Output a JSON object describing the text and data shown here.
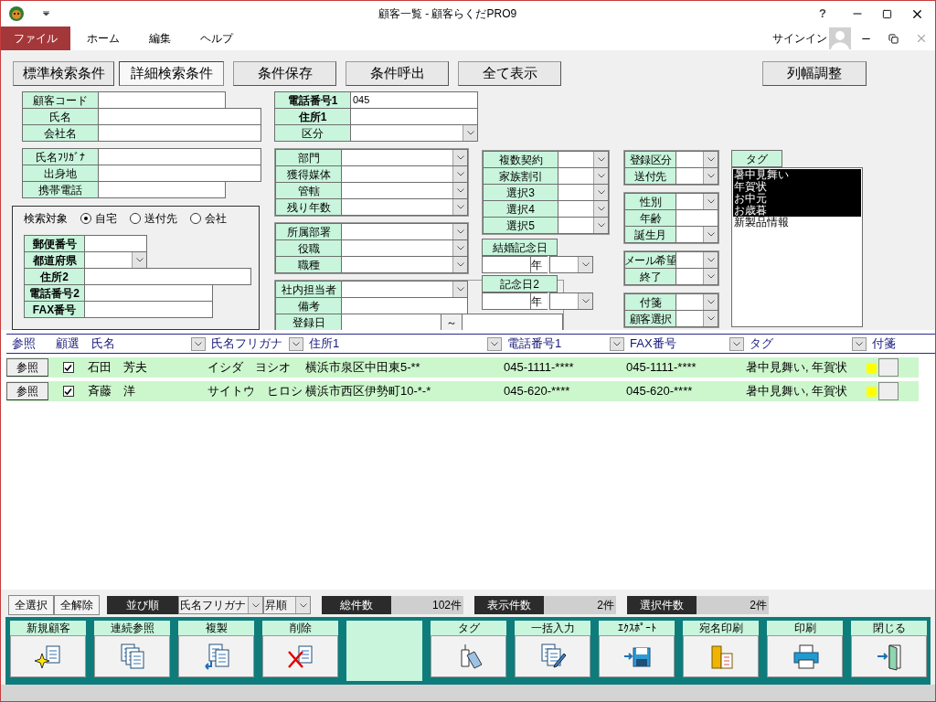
{
  "window": {
    "title": "顧客一覧 - 顧客らくだPRO9",
    "help": "?"
  },
  "menu": [
    {
      "label": "ファイル",
      "selected": true
    },
    {
      "label": "ホーム",
      "selected": false
    },
    {
      "label": "編集",
      "selected": false
    },
    {
      "label": "ヘルプ",
      "selected": false
    }
  ],
  "signin": "サインイン",
  "toolbar": [
    {
      "label": "標準検索条件",
      "selected": false
    },
    {
      "label": "詳細検索条件",
      "selected": true
    },
    {
      "label": "条件保存",
      "selected": false
    },
    {
      "label": "条件呼出",
      "selected": false
    },
    {
      "label": "全て表示",
      "selected": false
    },
    {
      "label": "列幅調整",
      "selected": false
    }
  ],
  "left_groups": [
    [
      {
        "label": "顧客コード",
        "kind": "text"
      },
      {
        "label": "氏名",
        "kind": "text"
      },
      {
        "label": "会社名",
        "kind": "text"
      }
    ],
    [
      {
        "label": "氏名ﾌﾘｶﾞﾅ",
        "kind": "text"
      },
      {
        "label": "出身地",
        "kind": "text"
      },
      {
        "label": "携帯電話",
        "kind": "text"
      }
    ]
  ],
  "search_scope": {
    "label": "検索対象",
    "options": [
      {
        "label": "自宅",
        "selected": true
      },
      {
        "label": "送付先",
        "selected": false
      },
      {
        "label": "会社",
        "selected": false
      }
    ]
  },
  "address_rows": [
    {
      "label": "郵便番号",
      "kind": "text"
    },
    {
      "label": "都道府県",
      "kind": "combo"
    },
    {
      "label": "住所2",
      "kind": "text"
    },
    {
      "label": "電話番号2",
      "kind": "text"
    },
    {
      "label": "FAX番号",
      "kind": "text"
    }
  ],
  "center_groups": [
    [
      {
        "label": "電話番号1",
        "kind": "text",
        "value": "045",
        "bold": true
      },
      {
        "label": "住所1",
        "kind": "text",
        "bold": true
      },
      {
        "label": "区分",
        "kind": "combo",
        "bold": false
      }
    ],
    [
      {
        "label": "部門",
        "kind": "combo"
      },
      {
        "label": "獲得媒体",
        "kind": "combo"
      },
      {
        "label": "管轄",
        "kind": "combo"
      },
      {
        "label": "残り年数",
        "kind": "combo"
      }
    ],
    [
      {
        "label": "所属部署",
        "kind": "combo"
      },
      {
        "label": "役職",
        "kind": "combo"
      },
      {
        "label": "職種",
        "kind": "combo"
      }
    ],
    [
      {
        "label": "社内担当者",
        "kind": "combo"
      },
      {
        "label": "備考",
        "kind": "text"
      },
      {
        "label": "登録日",
        "kind": "range",
        "separator": "～"
      }
    ]
  ],
  "option_rows": [
    {
      "label": "複数契約",
      "kind": "combo"
    },
    {
      "label": "家族割引",
      "kind": "combo"
    },
    {
      "label": "選択3",
      "kind": "combo"
    },
    {
      "label": "選択4",
      "kind": "combo"
    },
    {
      "label": "選択5",
      "kind": "combo"
    }
  ],
  "anniversaries": [
    {
      "label": "結婚記念日",
      "unit": "年"
    },
    {
      "label": "記念日2",
      "unit": "年"
    }
  ],
  "right_groups": [
    [
      {
        "label": "登録区分",
        "kind": "combo"
      },
      {
        "label": "送付先",
        "kind": "combo"
      }
    ],
    [
      {
        "label": "性別",
        "kind": "combo"
      },
      {
        "label": "年齢",
        "kind": "text"
      },
      {
        "label": "誕生月",
        "kind": "combo"
      }
    ],
    [
      {
        "label": "メール希望",
        "kind": "combo"
      },
      {
        "label": "終了",
        "kind": "combo"
      }
    ],
    [
      {
        "label": "付箋",
        "kind": "combo"
      },
      {
        "label": "顧客選択",
        "kind": "combo"
      }
    ]
  ],
  "tag_filter": {
    "label": "タグ",
    "items": [
      {
        "label": "暑中見舞い",
        "selected": true
      },
      {
        "label": "年賀状",
        "selected": true
      },
      {
        "label": "お中元",
        "selected": true
      },
      {
        "label": "お歳暮",
        "selected": true
      },
      {
        "label": "新製品情報",
        "selected": false
      }
    ]
  },
  "table": {
    "columns": [
      {
        "label": "参照",
        "filter": false
      },
      {
        "label": "顧選",
        "filter": false
      },
      {
        "label": "氏名",
        "filter": true
      },
      {
        "label": "氏名フリガナ",
        "filter": true
      },
      {
        "label": "住所1",
        "filter": true
      },
      {
        "label": "電話番号1",
        "filter": true
      },
      {
        "label": "FAX番号",
        "filter": true
      },
      {
        "label": "タグ",
        "filter": true
      },
      {
        "label": "付箋",
        "filter": false
      }
    ],
    "rows": [
      {
        "cells": [
          {
            "kind": "button",
            "text": "参照"
          },
          {
            "kind": "checkbox",
            "checked": true
          },
          {
            "kind": "text",
            "text": "石田　芳夫"
          },
          {
            "kind": "text",
            "text": "イシダ　ヨシオ"
          },
          {
            "kind": "text",
            "text": "横浜市泉区中田東5-**"
          },
          {
            "kind": "text",
            "text": "045-1111-****"
          },
          {
            "kind": "text",
            "text": "045-1111-****"
          },
          {
            "kind": "text",
            "text": "暑中見舞い, 年賀状"
          },
          {
            "kind": "flag",
            "flag": true
          }
        ]
      },
      {
        "cells": [
          {
            "kind": "button",
            "text": "参照"
          },
          {
            "kind": "checkbox",
            "checked": true
          },
          {
            "kind": "text",
            "text": "斉藤　洋"
          },
          {
            "kind": "text",
            "text": "サイトウ　ヒロシ"
          },
          {
            "kind": "text",
            "text": "横浜市西区伊勢町10-*-*"
          },
          {
            "kind": "text",
            "text": "045-620-****"
          },
          {
            "kind": "text",
            "text": "045-620-****"
          },
          {
            "kind": "text",
            "text": "暑中見舞い, 年賀状"
          },
          {
            "kind": "flag",
            "flag": true
          }
        ]
      }
    ]
  },
  "select_buttons": [
    "全選択",
    "全解除"
  ],
  "sort": {
    "label": "並び順",
    "field": "氏名フリガナ",
    "order": "昇順"
  },
  "counts": [
    {
      "label": "総件数",
      "value": "102件"
    },
    {
      "label": "表示件数",
      "value": "2件"
    },
    {
      "label": "選択件数",
      "value": "2件"
    }
  ],
  "actions": [
    {
      "label": "新規顧客",
      "kind": "new"
    },
    {
      "label": "連続参照",
      "kind": "browse"
    },
    {
      "label": "複製",
      "kind": "copy"
    },
    {
      "label": "削除",
      "kind": "delete"
    },
    {
      "kind": "blank"
    },
    {
      "label": "タグ",
      "kind": "tag"
    },
    {
      "label": "一括入力",
      "kind": "batch"
    },
    {
      "label": "ｴｸｽﾎﾟｰﾄ",
      "kind": "export"
    },
    {
      "label": "宛名印刷",
      "kind": "address"
    },
    {
      "label": "印刷",
      "kind": "print"
    },
    {
      "label": "閉じる",
      "kind": "close"
    }
  ]
}
